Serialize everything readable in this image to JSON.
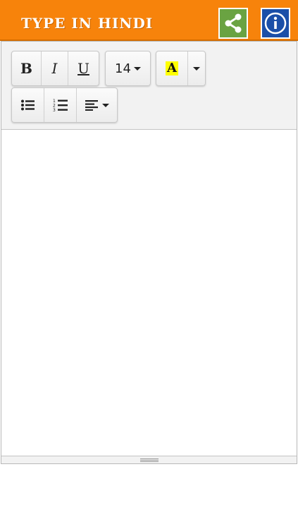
{
  "header": {
    "title": "TYPE IN HINDI",
    "share_icon": "share-icon",
    "info_icon": "info-icon",
    "colors": {
      "bar": "#f7830b",
      "share": "#6aa342",
      "info": "#1b4fa8"
    }
  },
  "toolbar": {
    "bold_label": "B",
    "italic_label": "I",
    "underline_label": "U",
    "font_size": "14",
    "text_color_label": "A",
    "highlight_color": "#ffff00"
  },
  "editor": {
    "content": ""
  }
}
